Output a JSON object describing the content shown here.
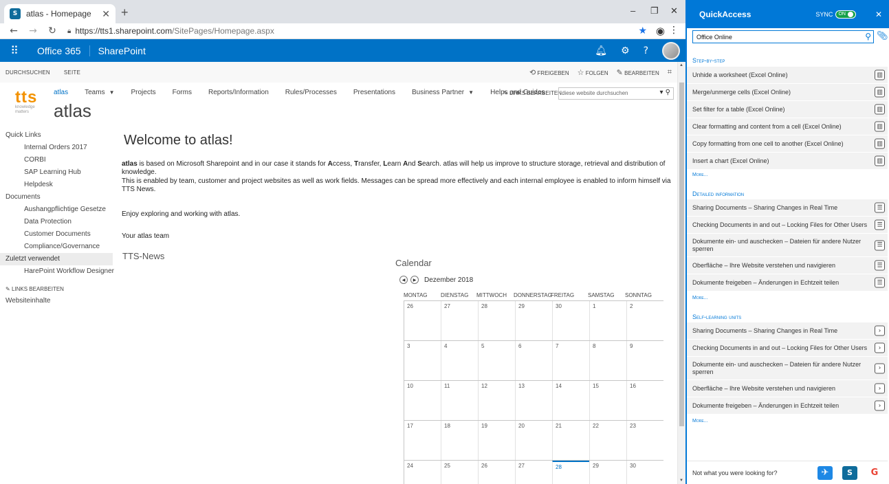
{
  "browser": {
    "tab_title": "atlas - Homepage",
    "new_tab": "+",
    "url_host": "https://tts1.sharepoint.com",
    "url_path": "/SitePages/Homepage.aspx"
  },
  "suitebar": {
    "app": "Office 365",
    "product": "SharePoint"
  },
  "ribbon": {
    "tabs": [
      "DURCHSUCHEN",
      "SEITE"
    ],
    "share": "FREIGEBEN",
    "follow": "FOLGEN",
    "edit": "BEARBEITEN"
  },
  "site": {
    "logo_text": "tts",
    "logo_tagline": "knowledge matters",
    "title": "atlas",
    "nav": [
      {
        "label": "atlas"
      },
      {
        "label": "Teams"
      },
      {
        "label": "Projects"
      },
      {
        "label": "Forms"
      },
      {
        "label": "Reports/Information"
      },
      {
        "label": "Rules/Processes"
      },
      {
        "label": "Presentations"
      },
      {
        "label": "Business Partner"
      },
      {
        "label": "Helps and Guides"
      }
    ],
    "edit_links": "LINKS BEARBEITEN",
    "search_placeholder": "diese website durchsuchen"
  },
  "quicklaunch": {
    "quick_links": "Quick Links",
    "ql_items": [
      "Internal Orders 2017",
      "CORBI",
      "SAP Learning Hub",
      "Helpdesk"
    ],
    "documents": "Documents",
    "doc_items": [
      "Aushangpflichtige Gesetze",
      "Data Protection",
      "Customer Documents",
      "Compliance/Governance"
    ],
    "recent": "Zuletzt verwendet",
    "recent_items": [
      "HarePoint Workflow Designer"
    ],
    "edit_links": "LINKS BEARBEITEN",
    "site_contents": "Websiteinhalte"
  },
  "content": {
    "welcome": "Welcome to atlas!",
    "p1_word_atlas": "atlas",
    "p1_a": " is based on Microsoft Sharepoint and in our case it stands for ",
    "p1_A": "A",
    "p1_ccess": "ccess, ",
    "p1_T": "T",
    "p1_ransfer": "ransfer, ",
    "p1_L": "L",
    "p1_earn": "earn ",
    "p1_And": "A",
    "p1_nd": "nd ",
    "p1_S": "S",
    "p1_rest": "earch. atlas will help us improve to structure storage, retrieval and distribution of knowledge.",
    "p2": "This is enabled by team, customer and project websites as well as work fields. Messages can be spread more effectively and each internal employee is enabled to inform himself via TTS News.",
    "p3": "Enjoy exploring and working with atlas.",
    "p4": "Your atlas team",
    "news": "TTS-News",
    "calendar": "Calendar",
    "month": "Dezember 2018"
  },
  "calendar": {
    "days": [
      "MONTAG",
      "DIENSTAG",
      "MITTWOCH",
      "DONNERSTAG",
      "FREITAG",
      "SAMSTAG",
      "SONNTAG"
    ],
    "weeks": [
      [
        "26",
        "27",
        "28",
        "29",
        "30",
        "1",
        "2"
      ],
      [
        "3",
        "4",
        "5",
        "6",
        "7",
        "8",
        "9"
      ],
      [
        "10",
        "11",
        "12",
        "13",
        "14",
        "15",
        "16"
      ],
      [
        "17",
        "18",
        "19",
        "20",
        "21",
        "22",
        "23"
      ],
      [
        "24",
        "25",
        "26",
        "27",
        "28",
        "29",
        "30"
      ]
    ],
    "today": "28"
  },
  "quickaccess": {
    "title": "QuickAccess",
    "sync": "SYNC",
    "sync_state": "ON",
    "search_value": "Office Online",
    "step_title": "Step-by-step",
    "steps": [
      "Unhide a worksheet (Excel Online)",
      "Merge/unmerge cells (Excel Online)",
      "Set filter for a table (Excel Online)",
      "Clear formatting and content from a cell (Excel Online)",
      "Copy formatting from one cell to another (Excel Online)",
      "Insert a chart (Excel Online)"
    ],
    "more": "More...",
    "detail_title": "Detailed information",
    "details": [
      "Sharing Documents – Sharing Changes in Real Time",
      "Checking Documents in and out – Locking Files for Other Users",
      "Dokumente ein- und auschecken – Dateien für andere Nutzer sperren",
      "Oberfläche – Ihre Website verstehen und navigieren",
      "Dokumente freigeben – Änderungen in Echtzeit teilen"
    ],
    "self_title": "Self-learning units",
    "selfs": [
      "Sharing Documents – Sharing Changes in Real Time",
      "Checking Documents in and out – Locking Files for Other Users",
      "Dokumente ein- und auschecken – Dateien für andere Nutzer sperren",
      "Oberfläche – Ihre Website verstehen und navigieren",
      "Dokumente freigeben – Änderungen in Echtzeit teilen"
    ],
    "footer": "Not what you were looking for?"
  }
}
